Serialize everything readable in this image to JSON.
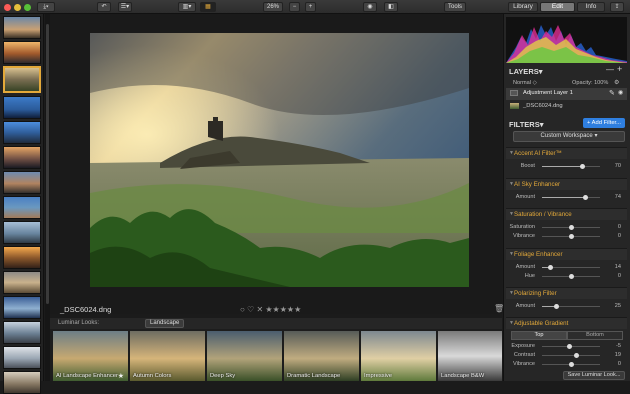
{
  "toolbar": {
    "zoom": "26%",
    "zoom_minus": "−",
    "zoom_plus": "+",
    "tools": "Tools",
    "tab_library": "Library",
    "tab_edit": "Edit",
    "tab_info": "Info"
  },
  "canvas": {
    "filename": "_DSC6024.dng",
    "rating": "○ ♡ ✕ ★★★★★"
  },
  "looks": {
    "label": "Luminar Looks:",
    "category": "Landscape",
    "items": [
      {
        "name": "AI Landscape Enhancer"
      },
      {
        "name": "Autumn Colors"
      },
      {
        "name": "Deep Sky"
      },
      {
        "name": "Dramatic Landscape"
      },
      {
        "name": "Impressive"
      },
      {
        "name": "Landscape B&W"
      }
    ]
  },
  "layers": {
    "title": "LAYERS",
    "add": "+",
    "mode": "Normal ◇",
    "opacity": "Opacity: 100%",
    "items": [
      {
        "name": "Adjustment Layer 1"
      },
      {
        "name": "_DSC6024.dng"
      }
    ]
  },
  "filters": {
    "title": "FILTERS",
    "add_filter": "+ Add Filter...",
    "workspace": "Custom Workspace",
    "groups": [
      {
        "name": "Accent AI Filter™",
        "sliders": [
          {
            "label": "Boost",
            "value": "70",
            "pct": 0.7
          }
        ]
      },
      {
        "name": "AI Sky Enhancer",
        "sliders": [
          {
            "label": "Amount",
            "value": "74",
            "pct": 0.74
          }
        ]
      },
      {
        "name": "Saturation / Vibrance",
        "sliders": [
          {
            "label": "Saturation",
            "value": "0",
            "pct": 0.5
          },
          {
            "label": "Vibrance",
            "value": "0",
            "pct": 0.5
          }
        ]
      },
      {
        "name": "Foliage Enhancer",
        "sliders": [
          {
            "label": "Amount",
            "value": "14",
            "pct": 0.14
          },
          {
            "label": "Hue",
            "value": "0",
            "pct": 0.5
          }
        ]
      },
      {
        "name": "Polarizing Filter",
        "sliders": [
          {
            "label": "Amount",
            "value": "25",
            "pct": 0.25
          }
        ]
      },
      {
        "name": "Adjustable Gradient",
        "sliders": []
      }
    ],
    "gradient": {
      "top": "Top",
      "bottom": "Bottom",
      "sliders": [
        {
          "label": "Exposure",
          "value": "-5",
          "pct": 0.47
        },
        {
          "label": "Contrast",
          "value": "19",
          "pct": 0.6
        },
        {
          "label": "Vibrance",
          "value": "0",
          "pct": 0.5
        }
      ]
    },
    "save": "Save Luminar Look..."
  },
  "colors": {
    "accent": "#e3a93a",
    "blue": "#2f7fe0"
  }
}
